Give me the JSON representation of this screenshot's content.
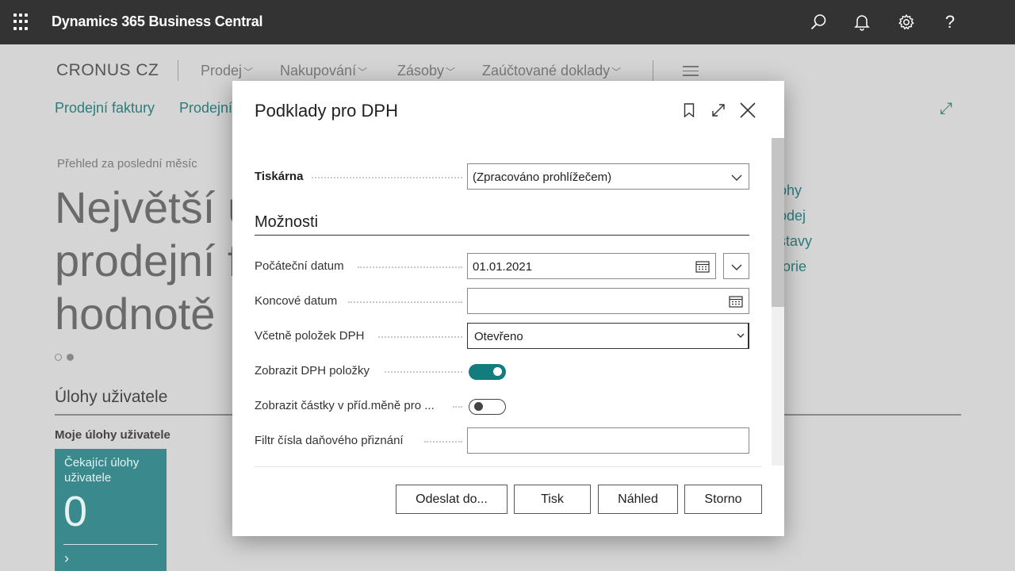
{
  "app": {
    "title": "Dynamics 365 Business Central"
  },
  "topbar_icons": [
    "search-icon",
    "bell-icon",
    "gear-icon",
    "help-icon"
  ],
  "background": {
    "company": "CRONUS CZ",
    "nav": [
      "Prodej",
      "Nakupování",
      "Zásoby",
      "Zaúčtované doklady"
    ],
    "actions": [
      "Prodejní faktury",
      "Prodejní"
    ],
    "overview_caption": "Přehled za poslední měsíc",
    "headline_lines": [
      "Největší ú",
      "prodejní f",
      "hodnotě"
    ],
    "right_links": [
      "ohy",
      "odej",
      "stavy",
      "torie"
    ],
    "section_title": "Úlohy uživatele",
    "sub_title": "Moje úlohy uživatele",
    "tile": {
      "title": "Čekající úlohy uživatele",
      "count": "0"
    }
  },
  "dialog": {
    "title": "Podklady pro DPH",
    "printer": {
      "label": "Tiskárna",
      "value": "(Zpracováno prohlížečem)"
    },
    "options_title": "Možnosti",
    "fields": {
      "start_date": {
        "label": "Počáteční datum",
        "value": "01.01.2021"
      },
      "end_date": {
        "label": "Koncové datum",
        "value": ""
      },
      "include_vat_entries": {
        "label": "Včetně položek DPH",
        "value": "Otevřeno"
      },
      "show_vat_entries": {
        "label": "Zobrazit DPH položky",
        "value": true
      },
      "show_fcy_amounts": {
        "label": "Zobrazit částky v příd.měně pro ...",
        "value": false
      },
      "vat_return_filter": {
        "label": "Filtr čísla daňového přiznání",
        "value": ""
      }
    },
    "buttons": {
      "send_to": "Odeslat do...",
      "print": "Tisk",
      "preview": "Náhled",
      "cancel": "Storno"
    }
  },
  "colors": {
    "appbar": "#333333",
    "accent": "#117d7d",
    "link": "#2c7c7b",
    "tile": "#3a8a8d"
  }
}
